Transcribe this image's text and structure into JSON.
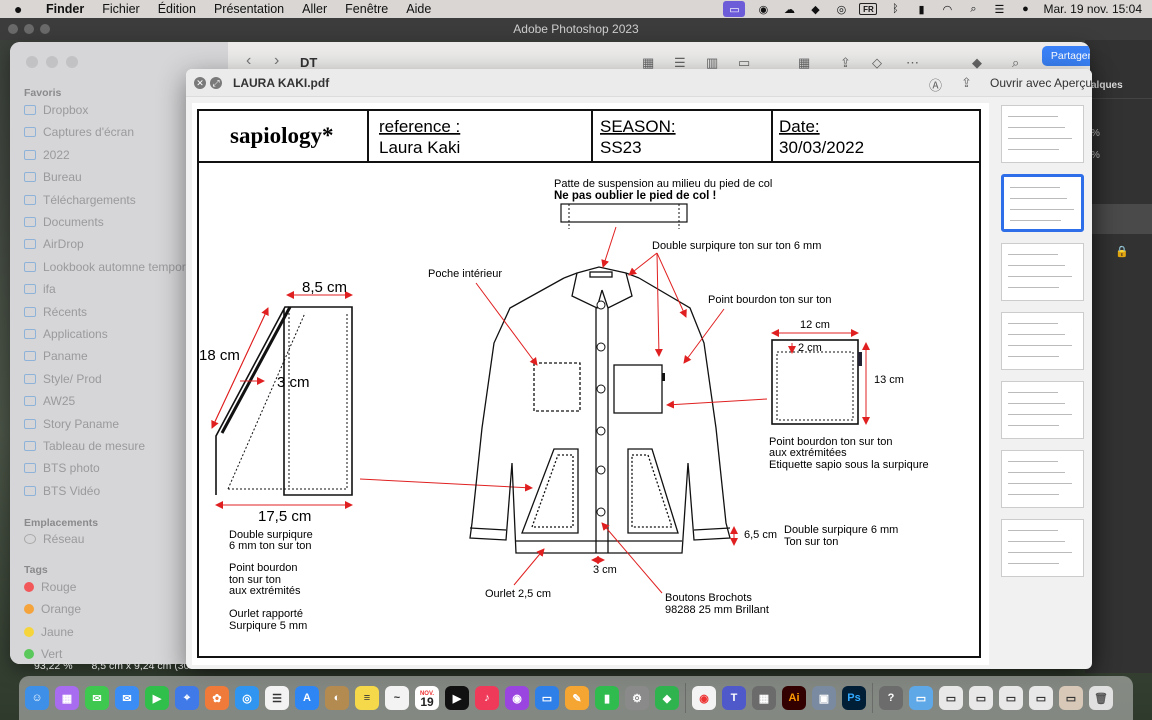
{
  "menubar": {
    "app": "Finder",
    "items": [
      "Fichier",
      "Édition",
      "Présentation",
      "Aller",
      "Fenêtre",
      "Aide"
    ],
    "input_badge": "FR",
    "clock": "Mar. 19 nov.  15:04"
  },
  "photoshop": {
    "title": "Adobe Photoshop 2023",
    "panel_tab": "alques",
    "pct1": "%",
    "pct2": "%"
  },
  "finder": {
    "path": "DT",
    "share_label": "Partager",
    "sidebar": {
      "favorites_title": "Favoris",
      "favorites": [
        "Dropbox",
        "Captures d'écran",
        "2022",
        "Bureau",
        "Téléchargements",
        "Documents",
        "AirDrop",
        "Lookbook automne temporaire",
        "ifa",
        "Récents",
        "Applications",
        "Paname",
        "Style/ Prod",
        "AW25",
        "Story Paname",
        "Tableau de mesure",
        "BTS photo",
        "BTS Vidéo"
      ],
      "locations_title": "Emplacements",
      "locations": [
        "Réseau"
      ],
      "tags_title": "Tags",
      "tags": [
        {
          "label": "Rouge",
          "color": "#f2575a"
        },
        {
          "label": "Orange",
          "color": "#f5a33b"
        },
        {
          "label": "Jaune",
          "color": "#f5d53b"
        },
        {
          "label": "Vert",
          "color": "#5ac85a"
        }
      ]
    },
    "status": {
      "zoom": "93,22 %",
      "size": "8,5 cm x 9,24 cm (300 ..."
    }
  },
  "quicklook": {
    "filename": "LAURA KAKI.pdf",
    "open_with": "Ouvrir avec Aperçu",
    "thumb_count": 7,
    "selected_thumb": 2
  },
  "sheet": {
    "brand": "sapiology*",
    "ref_label": "reference :",
    "ref_value": "Laura Kaki",
    "season_label": "SEASON:",
    "season_value": "SS23",
    "date_label": "Date:",
    "date_value": "30/03/2022",
    "notes": {
      "hang_1": "Patte de suspension au milieu du pied de col",
      "hang_2": "Ne pas oublier le pied de col !",
      "double_stitch": "Double surpiqure ton sur ton 6 mm",
      "inner_pocket": "Poche intérieur",
      "satin_stitch": "Point bourdon ton sur ton",
      "dim_85": "8,5 cm",
      "dim_18": "18 cm",
      "dim_3": "3 cm",
      "dim_175": "17,5 cm",
      "left_1a": "Double surpiqure",
      "left_1b": "6 mm ton sur ton",
      "left_2a": "Point bourdon",
      "left_2b": "ton sur ton",
      "left_2c": "aux extrémités",
      "left_3a": "Ourlet rapporté",
      "left_3b": "Surpiqure 5 mm",
      "dim_12": "12 cm",
      "dim_2": "2 cm",
      "dim_13": "13 cm",
      "right_1a": "Point bourdon ton sur ton",
      "right_1b": "aux extrémitées",
      "right_1c": "Etiquette sapio sous la surpiqure",
      "dim_65": "6,5 cm",
      "cuff_1": "Double surpiqure 6 mm",
      "cuff_2": "Ton sur ton",
      "dim_3b": "3 cm",
      "hem": "Ourlet 2,5 cm",
      "buttons_1": "Boutons Brochots",
      "buttons_2": "98288 25 mm Brillant"
    }
  },
  "dock": {
    "calendar_day": "19",
    "calendar_month": "NOV."
  }
}
